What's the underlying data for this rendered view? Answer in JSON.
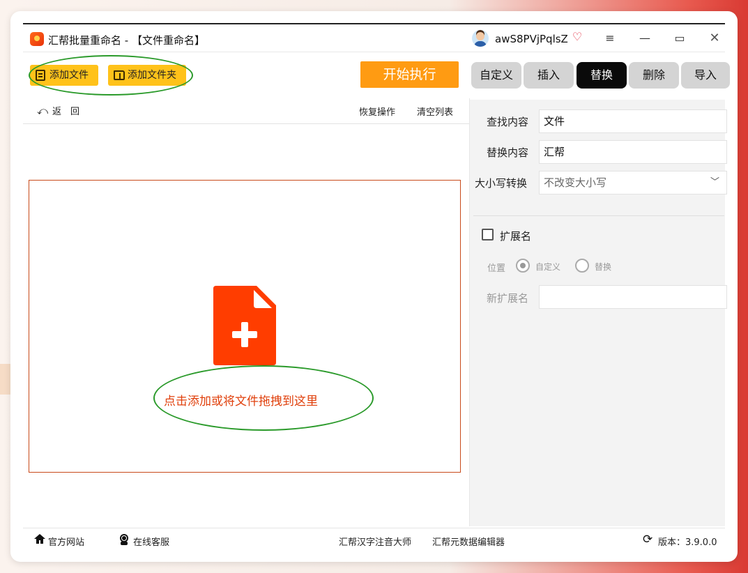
{
  "window": {
    "title": "汇帮批量重命名 - 【文件重命名】",
    "username": "awS8PVjPqlsZ",
    "menu_glyph": "≡",
    "min_glyph": "—",
    "max_glyph": "▭",
    "close_glyph": "✕"
  },
  "toolbar": {
    "add_file": "添加文件",
    "add_folder": "添加文件夹",
    "start": "开始执行",
    "back": "返　回",
    "back_glyph": "⤺",
    "restore": "恢复操作",
    "clear": "清空列表"
  },
  "drop_zone": {
    "hint": "点击添加或将文件拖拽到这里",
    "accent_color": "#ff3d00"
  },
  "tabs": [
    {
      "label": "自定义",
      "active": false
    },
    {
      "label": "插入",
      "active": false
    },
    {
      "label": "替换",
      "active": true
    },
    {
      "label": "删除",
      "active": false
    },
    {
      "label": "导入",
      "active": false
    }
  ],
  "replace_panel": {
    "find_label": "查找内容",
    "find_value": "文件",
    "replace_label": "替换内容",
    "replace_value": "汇帮",
    "case_label": "大小写转换",
    "case_value": "不改变大小写",
    "extension_label": "扩展名",
    "extension_checked": false,
    "position_label": "位置",
    "position_options": [
      "自定义",
      "替换"
    ],
    "position_selected": "自定义",
    "new_ext_label": "新扩展名",
    "new_ext_value": ""
  },
  "footer": {
    "official_site": "官方网站",
    "online_service": "在线客服",
    "pinyin_tool": "汇帮汉字注音大师",
    "metadata_tool": "汇帮元数据编辑器",
    "version": "版本：3.9.0.0"
  },
  "colors": {
    "accent_yellow": "#ffc21a",
    "start_orange": "#ff9b12",
    "active_tab": "#0a0a0a",
    "annotation_green": "#2a9a2a"
  }
}
